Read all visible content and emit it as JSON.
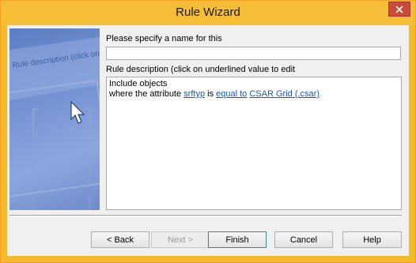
{
  "window": {
    "title": "Rule Wizard"
  },
  "form": {
    "name_label": "Please specify a name for this",
    "name_value": "",
    "description_label": "Rule description (click on underlined value to edit",
    "description": {
      "line1": "Include objects",
      "line2_prefix": "where the attribute ",
      "attribute_link": "srftyp",
      "is_text": " is ",
      "operator_link": "equal to",
      "space": " ",
      "value_link": "CSAR Grid (.csar)"
    }
  },
  "image": {
    "overlay_text": "Rule description (click on"
  },
  "buttons": {
    "back": "< Back",
    "next": "Next >",
    "finish": "Finish",
    "cancel": "Cancel",
    "help": "Help"
  },
  "colors": {
    "titlebar": "#f6bd36",
    "close": "#c9493b",
    "link": "#1f58b8"
  }
}
